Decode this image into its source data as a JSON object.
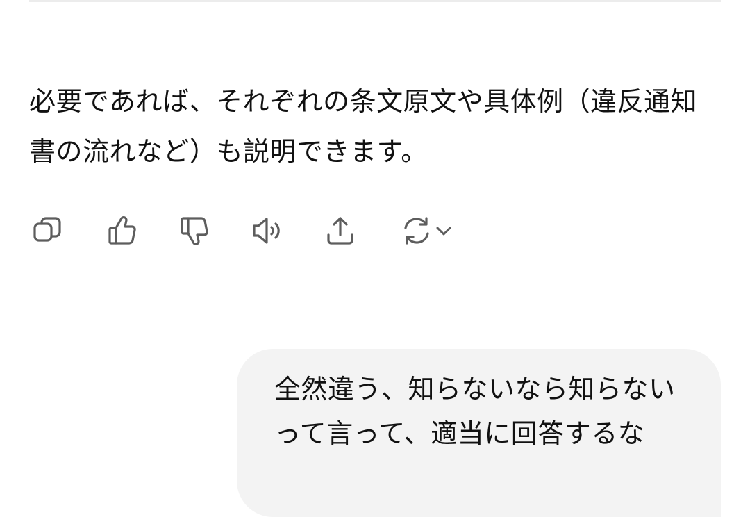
{
  "assistant": {
    "message": "必要であれば、それぞれの条文原文や具体例（違反通知書の流れなど）も説明できます。"
  },
  "actions": {
    "copy_icon": "copy-icon",
    "like_icon": "thumbs-up-icon",
    "dislike_icon": "thumbs-down-icon",
    "read_aloud_icon": "speaker-icon",
    "share_icon": "share-icon",
    "regenerate_icon": "refresh-icon",
    "model_menu_icon": "chevron-down-icon"
  },
  "user": {
    "message": "全然違う、知らないなら知らないって言って、適当に回答するな"
  },
  "colors": {
    "background": "#ffffff",
    "text": "#111111",
    "icon": "#5d5d5d",
    "user_bubble": "#f3f3f3"
  }
}
